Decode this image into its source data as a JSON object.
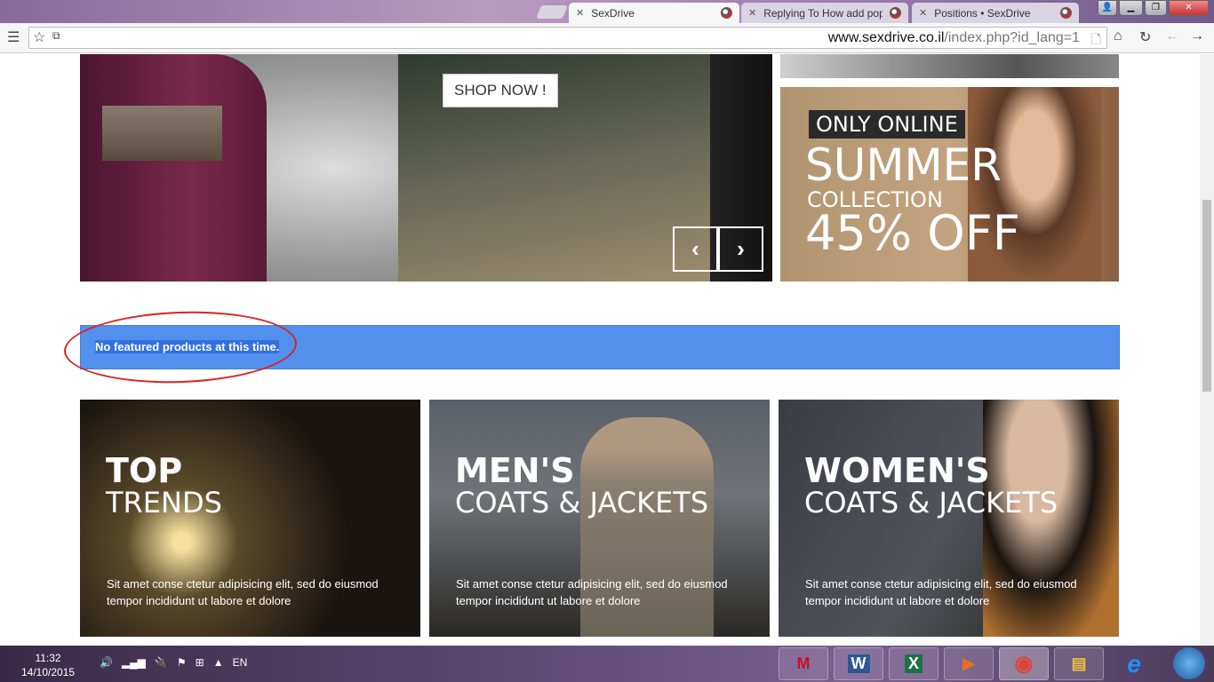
{
  "browser": {
    "tabs": [
      {
        "title": "SexDrive",
        "active": true
      },
      {
        "title": "Replying To How add pop",
        "active": false
      },
      {
        "title": "Positions • SexDrive",
        "active": false
      }
    ],
    "url_domain": "www.sexdrive.co.il",
    "url_path": "/index.php?id_lang=1"
  },
  "slider": {
    "button": "SHOP NOW !",
    "prev": "‹",
    "next": "›"
  },
  "promo": {
    "tag": "ONLY ONLINE",
    "line1": "SUMMER",
    "line2": "COLLECTION",
    "line3": "45% OFF"
  },
  "notice": "No featured products at this time.",
  "cards": [
    {
      "title": "TOP",
      "subtitle": "TRENDS",
      "text": "Sit amet conse ctetur adipisicing elit, sed do eiusmod tempor incididunt ut labore et dolore"
    },
    {
      "title": "MEN'S",
      "subtitle": "COATS & JACKETS",
      "text": "Sit amet conse ctetur adipisicing elit, sed do eiusmod tempor incididunt ut labore et dolore"
    },
    {
      "title": "WOMEN'S",
      "subtitle": "COATS & JACKETS",
      "text": "Sit amet conse ctetur adipisicing elit, sed do eiusmod tempor incididunt ut labore et dolore"
    }
  ],
  "taskbar": {
    "time": "11:32",
    "date": "14/10/2015",
    "lang": "EN",
    "apps": [
      {
        "label": "M",
        "color": "#c8102e"
      },
      {
        "label": "W",
        "color": "#2b5797"
      },
      {
        "label": "X",
        "color": "#1e7145"
      },
      {
        "label": "▶",
        "color": "#e07020"
      },
      {
        "label": "◉",
        "color": "#db4437"
      },
      {
        "label": "▤",
        "color": "#e8c040"
      },
      {
        "label": "e",
        "color": "#1e90ff"
      }
    ]
  }
}
